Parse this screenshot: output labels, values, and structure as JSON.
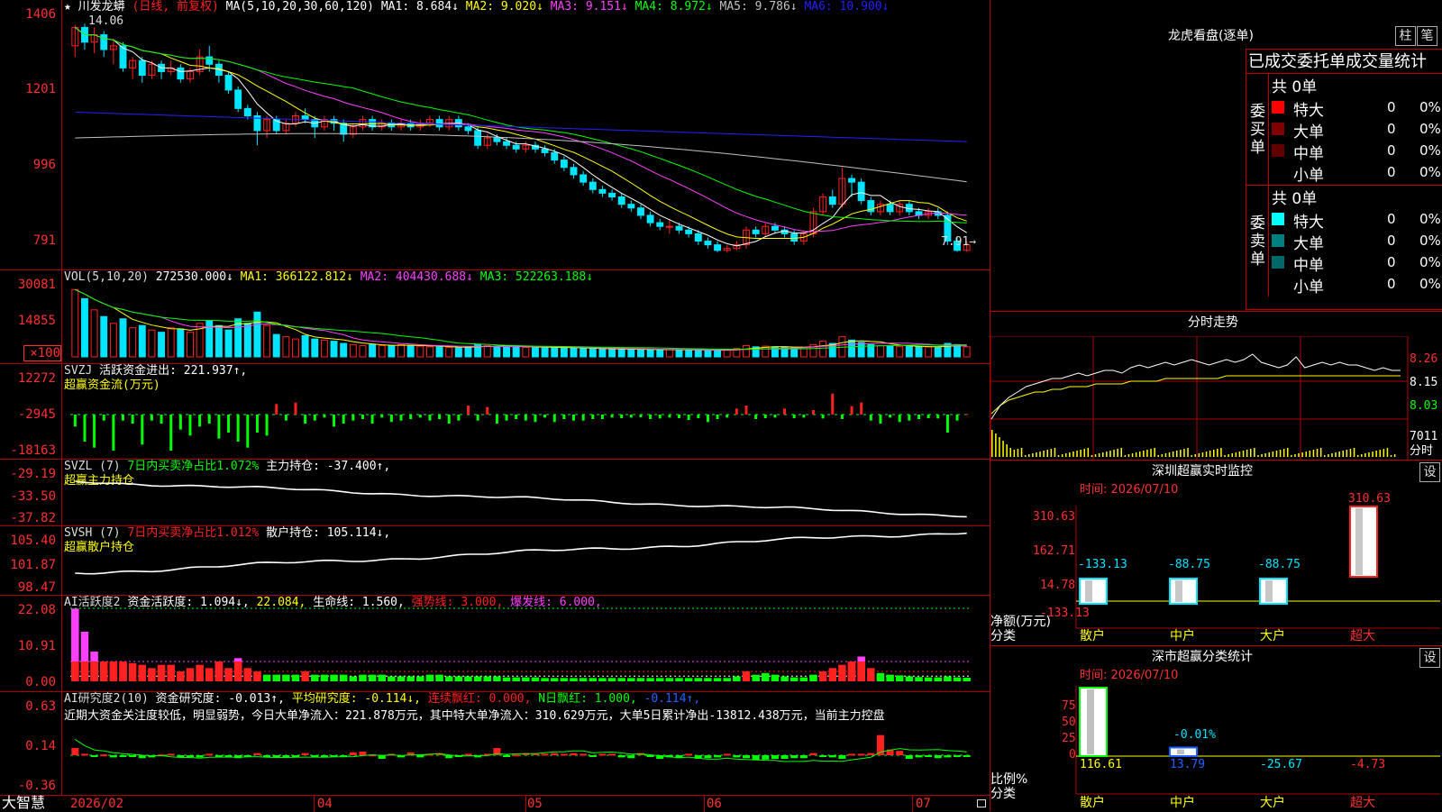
{
  "colors": {
    "bg": "#000000",
    "grid_red": "#b00000",
    "up": "#ff2020",
    "down": "#00e5ff",
    "ma1": "#ffffff",
    "ma2": "#ffff00",
    "ma3": "#ff40ff",
    "ma4": "#00ff00",
    "ma5": "#c0c0c0",
    "ma6": "#2020ff",
    "green": "#00ff00",
    "magenta": "#ff40ff",
    "yellow": "#ffff00"
  },
  "kline": {
    "header": {
      "star": "★",
      "name": "川发龙蟒",
      "mode": "(日线, 前复权)",
      "ma_def": "MA(5,10,20,30,60,120)",
      "ma1": "MA1: 8.684↓",
      "ma2": "MA2: 9.020↓",
      "ma3": "MA3: 9.151↓",
      "ma4": "MA4: 8.972↓",
      "ma5": "MA5: 9.786↓",
      "ma6": "MA6: 10.900↓"
    },
    "y_ticks": [
      "1406",
      "1201",
      "996",
      "791"
    ],
    "y_values": [
      14.06,
      12.01,
      9.96,
      7.91
    ],
    "high_label": "14.06",
    "low_label": "7.91→",
    "candles": [
      [
        13.5,
        14.0,
        13.2,
        14.06
      ],
      [
        14.0,
        13.6,
        13.4,
        14.1
      ],
      [
        13.6,
        13.8,
        13.3,
        14.0
      ],
      [
        13.8,
        13.4,
        13.2,
        13.9
      ],
      [
        13.4,
        13.5,
        13.0,
        13.7
      ],
      [
        13.5,
        12.9,
        12.8,
        13.6
      ],
      [
        12.9,
        13.1,
        12.6,
        13.2
      ],
      [
        13.1,
        12.7,
        12.5,
        13.2
      ],
      [
        12.7,
        13.0,
        12.6,
        13.1
      ],
      [
        13.0,
        12.8,
        12.6,
        13.1
      ],
      [
        12.8,
        12.9,
        12.7,
        13.1
      ],
      [
        12.9,
        12.6,
        12.5,
        13.0
      ],
      [
        12.6,
        12.8,
        12.5,
        12.9
      ],
      [
        12.8,
        13.2,
        12.7,
        13.4
      ],
      [
        13.2,
        13.0,
        12.8,
        13.5
      ],
      [
        13.0,
        12.7,
        12.5,
        13.1
      ],
      [
        12.7,
        12.3,
        12.2,
        12.8
      ],
      [
        12.3,
        11.8,
        11.7,
        12.4
      ],
      [
        11.8,
        11.6,
        11.5,
        11.9
      ],
      [
        11.6,
        11.2,
        10.8,
        11.7
      ],
      [
        11.2,
        11.5,
        11.0,
        11.6
      ],
      [
        11.5,
        11.2,
        11.1,
        11.6
      ],
      [
        11.2,
        11.4,
        11.1,
        11.5
      ],
      [
        11.4,
        11.6,
        11.3,
        11.7
      ],
      [
        11.6,
        11.5,
        11.4,
        11.8
      ],
      [
        11.5,
        11.3,
        11.0,
        11.6
      ],
      [
        11.3,
        11.5,
        11.2,
        11.6
      ],
      [
        11.5,
        11.4,
        11.2,
        11.6
      ],
      [
        11.4,
        11.1,
        10.9,
        11.5
      ],
      [
        11.1,
        11.3,
        11.0,
        11.4
      ],
      [
        11.3,
        11.5,
        11.2,
        11.6
      ],
      [
        11.5,
        11.3,
        11.2,
        11.6
      ],
      [
        11.3,
        11.4,
        11.2,
        11.5
      ],
      [
        11.4,
        11.3,
        11.2,
        11.5
      ],
      [
        11.3,
        11.4,
        11.2,
        11.5
      ],
      [
        11.4,
        11.3,
        11.2,
        11.5
      ],
      [
        11.3,
        11.4,
        11.2,
        11.5
      ],
      [
        11.4,
        11.5,
        11.3,
        11.6
      ],
      [
        11.5,
        11.3,
        11.2,
        11.6
      ],
      [
        11.3,
        11.5,
        11.2,
        11.6
      ],
      [
        11.5,
        11.3,
        11.2,
        11.6
      ],
      [
        11.3,
        11.2,
        11.1,
        11.4
      ],
      [
        11.2,
        10.8,
        10.7,
        11.3
      ],
      [
        10.8,
        11.0,
        10.7,
        11.1
      ],
      [
        11.0,
        10.9,
        10.8,
        11.1
      ],
      [
        10.9,
        10.8,
        10.7,
        11.0
      ],
      [
        10.8,
        10.7,
        10.6,
        10.9
      ],
      [
        10.7,
        10.8,
        10.6,
        10.9
      ],
      [
        10.8,
        10.7,
        10.6,
        10.9
      ],
      [
        10.7,
        10.6,
        10.5,
        10.8
      ],
      [
        10.6,
        10.4,
        10.3,
        10.7
      ],
      [
        10.4,
        10.2,
        10.1,
        10.5
      ],
      [
        10.2,
        10.0,
        9.9,
        10.3
      ],
      [
        10.0,
        9.8,
        9.7,
        10.1
      ],
      [
        9.8,
        9.6,
        9.5,
        9.9
      ],
      [
        9.6,
        9.5,
        9.4,
        9.7
      ],
      [
        9.5,
        9.4,
        9.3,
        9.6
      ],
      [
        9.4,
        9.2,
        9.1,
        9.5
      ],
      [
        9.2,
        9.1,
        9.0,
        9.3
      ],
      [
        9.1,
        8.9,
        8.8,
        9.2
      ],
      [
        8.9,
        8.7,
        8.6,
        9.0
      ],
      [
        8.7,
        8.6,
        8.5,
        8.8
      ],
      [
        8.6,
        8.6,
        8.4,
        8.8
      ],
      [
        8.6,
        8.5,
        8.4,
        8.7
      ],
      [
        8.5,
        8.4,
        8.3,
        8.6
      ],
      [
        8.4,
        8.2,
        8.1,
        8.5
      ],
      [
        8.2,
        8.1,
        8.0,
        8.3
      ],
      [
        8.1,
        7.95,
        7.9,
        8.2
      ],
      [
        7.95,
        8.0,
        7.9,
        8.1
      ],
      [
        8.0,
        8.1,
        7.95,
        8.2
      ],
      [
        8.1,
        8.5,
        8.0,
        8.6
      ],
      [
        8.5,
        8.4,
        8.3,
        8.6
      ],
      [
        8.4,
        8.6,
        8.3,
        8.7
      ],
      [
        8.6,
        8.5,
        8.4,
        8.7
      ],
      [
        8.5,
        8.4,
        8.3,
        8.6
      ],
      [
        8.4,
        8.2,
        8.1,
        8.5
      ],
      [
        8.2,
        8.4,
        8.1,
        8.5
      ],
      [
        8.4,
        9.0,
        8.3,
        9.1
      ],
      [
        9.0,
        9.4,
        8.9,
        9.5
      ],
      [
        9.4,
        9.2,
        9.1,
        9.6
      ],
      [
        9.2,
        9.9,
        9.1,
        10.2
      ],
      [
        9.9,
        9.8,
        9.4,
        10.0
      ],
      [
        9.8,
        9.3,
        9.2,
        9.9
      ],
      [
        9.3,
        9.0,
        8.9,
        9.4
      ],
      [
        9.0,
        9.2,
        8.9,
        9.3
      ],
      [
        9.2,
        9.0,
        8.9,
        9.3
      ],
      [
        9.0,
        9.2,
        8.9,
        9.3
      ],
      [
        9.2,
        9.0,
        8.9,
        9.3
      ],
      [
        9.0,
        8.9,
        8.8,
        9.1
      ],
      [
        8.9,
        9.0,
        8.8,
        9.1
      ],
      [
        9.0,
        8.9,
        8.8,
        9.1
      ],
      [
        8.9,
        8.2,
        8.1,
        9.0
      ],
      [
        8.2,
        7.95,
        7.91,
        8.3
      ],
      [
        7.95,
        8.1,
        7.91,
        8.2
      ]
    ],
    "ma_last": {
      "ma1": 8.684,
      "ma2": 9.02,
      "ma3": 9.151,
      "ma4": 8.972,
      "ma5": 9.786,
      "ma6": 10.9
    }
  },
  "vol": {
    "header": {
      "label": "VOL(5,10,20)",
      "value": "272530.000↓",
      "ma1": "MA1: 366122.812↓",
      "ma2": "MA2: 404430.688↓",
      "ma3": "MA3: 522263.188↓"
    },
    "y_ticks": [
      "30081",
      "14855",
      "×100"
    ],
    "values": [
      30081,
      26000,
      21000,
      18000,
      15000,
      17000,
      13000,
      14000,
      12000,
      11000,
      13000,
      12500,
      11000,
      15000,
      16000,
      14000,
      12000,
      17000,
      15000,
      20000,
      14000,
      10000,
      9000,
      8000,
      9500,
      8000,
      7500,
      7000,
      6000,
      5500,
      5000,
      5500,
      5000,
      5000,
      5500,
      5000,
      4800,
      4500,
      4500,
      4200,
      4000,
      4500,
      5500,
      5000,
      4800,
      4500,
      4500,
      4200,
      4000,
      4500,
      4200,
      4000,
      3800,
      3700,
      3600,
      3500,
      3500,
      3400,
      3300,
      3300,
      3200,
      3100,
      3200,
      3100,
      3000,
      3000,
      2900,
      2800,
      3200,
      3800,
      5000,
      4500,
      4800,
      4500,
      4200,
      4000,
      4200,
      5500,
      7000,
      6000,
      9000,
      7500,
      6500,
      5500,
      5000,
      4800,
      4700,
      4600,
      4500,
      4400,
      4300,
      6000,
      5500,
      4500
    ]
  },
  "svzj": {
    "header": {
      "label": "SVZJ",
      "title": "活跃资金进出: 221.937↑,",
      "sub": "超赢资金流(万元)"
    },
    "y_ticks": [
      "12272",
      "-2945",
      "-18163"
    ],
    "values": [
      -4000,
      -9000,
      -11000,
      -2000,
      -12000,
      -2000,
      -3000,
      -10000,
      -2000,
      -3000,
      -12000,
      -5000,
      -7000,
      -4000,
      -3000,
      -8000,
      -6000,
      -9000,
      -11000,
      -6000,
      -7000,
      3500,
      -2000,
      4000,
      -3000,
      -2000,
      -1000,
      -4000,
      -3000,
      -2000,
      -1500,
      -3000,
      -1000,
      -2500,
      -2000,
      -1500,
      -1000,
      -2000,
      -1500,
      -3000,
      -2000,
      3000,
      -2000,
      2500,
      -3000,
      -2000,
      -1500,
      -2000,
      -2500,
      -1000,
      -2500,
      -1500,
      -2000,
      -2000,
      -1500,
      -1500,
      -1000,
      -1200,
      -1000,
      -900,
      -1500,
      -1300,
      -1000,
      -1200,
      -1800,
      -1200,
      -2500,
      -1500,
      -1000,
      2000,
      3000,
      -1500,
      -1200,
      -1000,
      2000,
      -1200,
      -1000,
      1500,
      -1300,
      7000,
      -1500,
      2800,
      4000,
      -2000,
      -3000,
      -1000,
      -2500,
      -2000,
      -1500,
      -1200,
      -1300,
      -6000,
      -2000,
      221.937
    ]
  },
  "svzl": {
    "header": {
      "label": "SVZL (7)",
      "ratio": "7日内买卖净占比1.072%",
      "hold": "主力持仓: -37.400↑,",
      "sub": "超赢主力持仓"
    },
    "y_ticks": [
      "-29.19",
      "-33.50",
      "-37.82"
    ]
  },
  "svsh": {
    "header": {
      "label": "SVSH (7)",
      "ratio": "7日内买卖净占比1.012%",
      "hold": "散户持仓: 105.114↓,",
      "sub": "超赢散户持仓"
    },
    "y_ticks": [
      "105.40",
      "101.87",
      "98.47"
    ]
  },
  "ai_active": {
    "header": {
      "label": "AI活跃度2",
      "t1": "资金活跃度: 1.094↓,",
      "t2": "22.084,",
      "t3": "生命线: 1.560,",
      "t4": "强势线: 3.000,",
      "t5": "爆发线: 6.000,"
    },
    "y_ticks": [
      "22.08",
      "10.91",
      "0.00"
    ],
    "values": [
      22,
      15,
      9,
      6,
      6,
      6,
      5.5,
      5,
      4,
      5,
      5,
      3,
      4,
      5,
      4,
      6,
      4,
      7,
      4,
      3,
      2,
      2,
      2,
      2,
      3,
      2,
      2,
      2,
      2,
      1.5,
      2,
      2,
      2,
      1.5,
      1.5,
      1.5,
      1.5,
      2,
      2,
      1.5,
      1.5,
      1.5,
      1.5,
      1.5,
      1.5,
      1.2,
      1.2,
      1.2,
      1.2,
      1,
      1,
      1,
      1,
      1,
      1,
      1,
      1,
      1,
      1,
      1,
      1,
      1,
      1,
      1,
      1,
      1,
      1,
      1,
      1,
      1.5,
      3,
      2,
      2.5,
      2,
      1.5,
      1.2,
      1.2,
      2,
      3,
      4,
      5,
      6,
      7.5,
      4,
      2.5,
      2,
      1.8,
      1.5,
      1.3,
      1.2,
      1.2,
      1.5,
      1.2,
      1.1
    ]
  },
  "ai_research": {
    "header": {
      "label": "AI研究度2(10)",
      "t1": "资金研究度: -0.013↑,",
      "t2": "平均研究度: -0.114↓,",
      "t3": "连续飘红: 0.000,",
      "t4": "N日飘红: 1.000,",
      "t5": "-0.114↑,"
    },
    "comment": "近期大资金关注度较低，明显弱势，今日大单净流入：221.878万元，其中特大单净流入：310.629万元，大单5日累计净出-13812.438万元，当前主力控盘",
    "y_ticks": [
      "0.63",
      "0.14",
      "-0.36"
    ],
    "values": [
      0.1,
      0.02,
      -0.02,
      0.01,
      -0.03,
      -0.02,
      -0.02,
      -0.04,
      -0.03,
      0.01,
      0.02,
      -0.02,
      -0.02,
      -0.03,
      0.02,
      -0.01,
      -0.02,
      -0.04,
      -0.02,
      0.03,
      -0.02,
      -0.03,
      -0.02,
      -0.02,
      0.03,
      -0.01,
      -0.03,
      -0.02,
      -0.01,
      0.04,
      0.05,
      0.01,
      -0.05,
      0.02,
      -0.03,
      0.04,
      -0.03,
      0.02,
      0.03,
      -0.04,
      -0.02,
      0.02,
      -0.03,
      0.02,
      0.1,
      -0.02,
      0.01,
      0.03,
      0.03,
      0.02,
      0.03,
      0.02,
      0.03,
      0.02,
      -0.02,
      0.02,
      0.02,
      -0.03,
      -0.04,
      0.03,
      -0.02,
      -0.05,
      -0.03,
      -0.04,
      0.02,
      -0.05,
      -0.04,
      -0.03,
      0.02,
      -0.03,
      -0.04,
      -0.07,
      -0.06,
      -0.05,
      -0.05,
      -0.04,
      -0.04,
      0.03,
      -0.02,
      -0.03,
      -0.05,
      0.02,
      0.02,
      0.03,
      0.28,
      0.08,
      0.06,
      -0.05,
      -0.03,
      -0.02,
      -0.04,
      -0.03,
      -0.02,
      -0.013
    ]
  },
  "x_axis": {
    "labels": [
      "2026/02",
      "04",
      "05",
      "06",
      "07"
    ],
    "brand": "大智慧"
  },
  "longhu": {
    "title": "龙虎看盘(逐单)",
    "btn_zhu": "柱",
    "btn_bi": "笔",
    "stats_title": "已成交委托单成交量统计",
    "buy_label": "委买单",
    "sell_label": "委卖单",
    "buy_total": "共 0单",
    "sell_total": "共 0单",
    "buy_rows": [
      {
        "name": "特大",
        "count": "0",
        "pct": "0%",
        "color": "#ff0000"
      },
      {
        "name": "大单",
        "count": "0",
        "pct": "0%",
        "color": "#800000"
      },
      {
        "name": "中单",
        "count": "0",
        "pct": "0%",
        "color": "#600000"
      },
      {
        "name": "小单",
        "count": "0",
        "pct": "0%",
        "color": "#000000"
      }
    ],
    "sell_rows": [
      {
        "name": "特大",
        "count": "0",
        "pct": "0%",
        "color": "#00ffff"
      },
      {
        "name": "大单",
        "count": "0",
        "pct": "0%",
        "color": "#008080"
      },
      {
        "name": "中单",
        "count": "0",
        "pct": "0%",
        "color": "#006868"
      },
      {
        "name": "小单",
        "count": "0",
        "pct": "0%",
        "color": "#000000"
      }
    ]
  },
  "intraday": {
    "title": "分时走势",
    "y_ticks": [
      "8.26",
      "8.15",
      "8.03"
    ],
    "vol_label": "7011",
    "unit_label": "分时",
    "price": [
      8.0,
      8.05,
      8.08,
      8.1,
      8.12,
      8.13,
      8.14,
      8.15,
      8.15,
      8.16,
      8.17,
      8.16,
      8.17,
      8.18,
      8.18,
      8.17,
      8.19,
      8.2,
      8.19,
      8.2,
      8.21,
      8.2,
      8.21,
      8.22,
      8.21,
      8.2,
      8.21,
      8.22,
      8.21,
      8.22,
      8.24,
      8.21,
      8.2,
      8.19,
      8.2,
      8.23,
      8.19,
      8.2,
      8.21,
      8.2,
      8.21,
      8.2,
      8.2,
      8.19,
      8.18,
      8.19,
      8.18,
      8.18
    ],
    "avg": [
      8.02,
      8.05,
      8.07,
      8.08,
      8.09,
      8.1,
      8.1,
      8.11,
      8.11,
      8.12,
      8.12,
      8.12,
      8.13,
      8.13,
      8.13,
      8.13,
      8.14,
      8.14,
      8.14,
      8.14,
      8.15,
      8.15,
      8.15,
      8.15,
      8.15,
      8.15,
      8.15,
      8.16,
      8.16,
      8.16,
      8.16,
      8.16,
      8.16,
      8.16,
      8.16,
      8.16,
      8.16,
      8.16,
      8.16,
      8.16,
      8.16,
      8.16,
      8.16,
      8.16,
      8.16,
      8.16,
      8.16,
      8.16
    ]
  },
  "sz_monitor": {
    "title": "深圳超赢实时监控",
    "btn": "设",
    "time": "时间: 2026/07/10",
    "y_ticks": [
      "310.63",
      "162.71",
      "14.78",
      "-133.13"
    ],
    "y_label1": "净额(万元)",
    "y_label2": "分类",
    "bars": [
      {
        "cat": "散户",
        "value": -133.13,
        "label": "-133.13"
      },
      {
        "cat": "中户",
        "value": -88.75,
        "label": "-88.75"
      },
      {
        "cat": "大户",
        "value": -88.75,
        "label": "-88.75"
      },
      {
        "cat": "超大",
        "value": 310.63,
        "label": "310.63"
      }
    ]
  },
  "sz_class": {
    "title": "深市超赢分类统计",
    "btn": "设",
    "time": "时间: 2026/07/10",
    "y_ticks": [
      "75",
      "50",
      "25",
      "0"
    ],
    "y_label1": "比例%",
    "y_label2": "分类",
    "bars": [
      {
        "cat": "散户",
        "value": 80,
        "label": "116.61"
      },
      {
        "cat": "中户",
        "value": 10,
        "label": "13.79",
        "top_label": "-0.01%"
      },
      {
        "cat": "大户",
        "value": 0,
        "label": "-25.67"
      },
      {
        "cat": "超大",
        "value": 0,
        "label": "-4.73"
      }
    ]
  }
}
